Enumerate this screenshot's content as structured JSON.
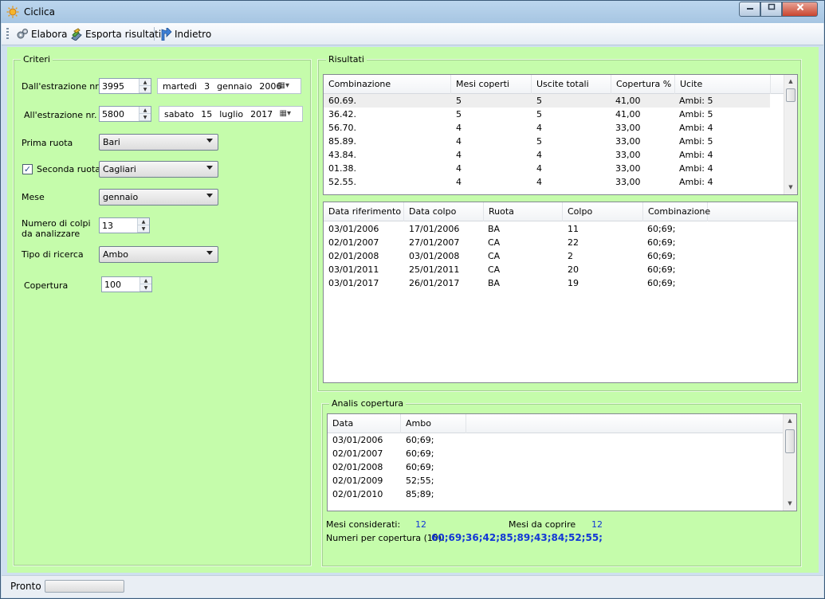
{
  "window": {
    "title": "Ciclica"
  },
  "toolbar": {
    "elabora": "Elabora",
    "esporta": "Esporta risultati",
    "indietro": "Indietro"
  },
  "criteri": {
    "group_label": "Criteri",
    "dall_label": "Dall'estrazione nr.",
    "dall_value": "3995",
    "dall_date": {
      "weekday": "martedì",
      "day": "3",
      "month": "gennaio",
      "year": "2006"
    },
    "all_label": "All'estrazione nr.",
    "all_value": "5800",
    "all_date": {
      "weekday": "sabato",
      "day": "15",
      "month": "luglio",
      "year": "2017"
    },
    "prima_label": "Prima ruota",
    "prima_value": "Bari",
    "seconda_label": "Seconda ruota",
    "seconda_checked": true,
    "seconda_value": "Cagliari",
    "mese_label": "Mese",
    "mese_value": "gennaio",
    "colpi_label_1": "Numero di colpi",
    "colpi_label_2": "da analizzare",
    "colpi_value": "13",
    "tipo_label": "Tipo di ricerca",
    "tipo_value": "Ambo",
    "copertura_label": "Copertura",
    "copertura_value": "100"
  },
  "risultati": {
    "group_label": "Risultati",
    "columns": [
      "Combinazione",
      "Mesi coperti",
      "Uscite totali",
      "Copertura %",
      "Ucite"
    ],
    "rows": [
      [
        "60.69.",
        "5",
        "5",
        "41,00",
        "Ambi: 5"
      ],
      [
        "36.42.",
        "5",
        "5",
        "41,00",
        "Ambi: 5"
      ],
      [
        "56.70.",
        "4",
        "4",
        "33,00",
        "Ambi: 4"
      ],
      [
        "85.89.",
        "4",
        "5",
        "33,00",
        "Ambi: 5"
      ],
      [
        "43.84.",
        "4",
        "4",
        "33,00",
        "Ambi: 4"
      ],
      [
        "01.38.",
        "4",
        "4",
        "33,00",
        "Ambi: 4"
      ],
      [
        "52.55.",
        "4",
        "4",
        "33,00",
        "Ambi: 4"
      ]
    ]
  },
  "dettaglio": {
    "columns": [
      "Data riferimento",
      "Data colpo",
      "Ruota",
      "Colpo",
      "Combinazione"
    ],
    "rows": [
      [
        "03/01/2006",
        "17/01/2006",
        "BA",
        "11",
        "60;69;"
      ],
      [
        "02/01/2007",
        "27/01/2007",
        "CA",
        "22",
        "60;69;"
      ],
      [
        "02/01/2008",
        "03/01/2008",
        "CA",
        "2",
        "60;69;"
      ],
      [
        "03/01/2011",
        "25/01/2011",
        "CA",
        "20",
        "60;69;"
      ],
      [
        "03/01/2017",
        "26/01/2017",
        "BA",
        "19",
        "60;69;"
      ]
    ]
  },
  "analisi": {
    "group_label": "Analis copertura",
    "columns": [
      "Data",
      "Ambo"
    ],
    "rows": [
      [
        "03/01/2006",
        "60;69;"
      ],
      [
        "02/01/2007",
        "60;69;"
      ],
      [
        "02/01/2008",
        "60;69;"
      ],
      [
        "02/01/2009",
        "52;55;"
      ],
      [
        "02/01/2010",
        "85;89;"
      ]
    ],
    "mesi_considerati_label": "Mesi considerati:",
    "mesi_considerati_value": "12",
    "mesi_da_coprire_label": "Mesi da coprire",
    "mesi_da_coprire_value": "12",
    "numeri_label": "Numeri per copertura (10):",
    "numeri_value": "60;69;36;42;85;89;43;84;52;55;"
  },
  "status": {
    "text": "Pronto",
    "progress": 0
  },
  "colors": {
    "client_bg": "#c5fcab",
    "accent_blue": "#1236d6"
  }
}
